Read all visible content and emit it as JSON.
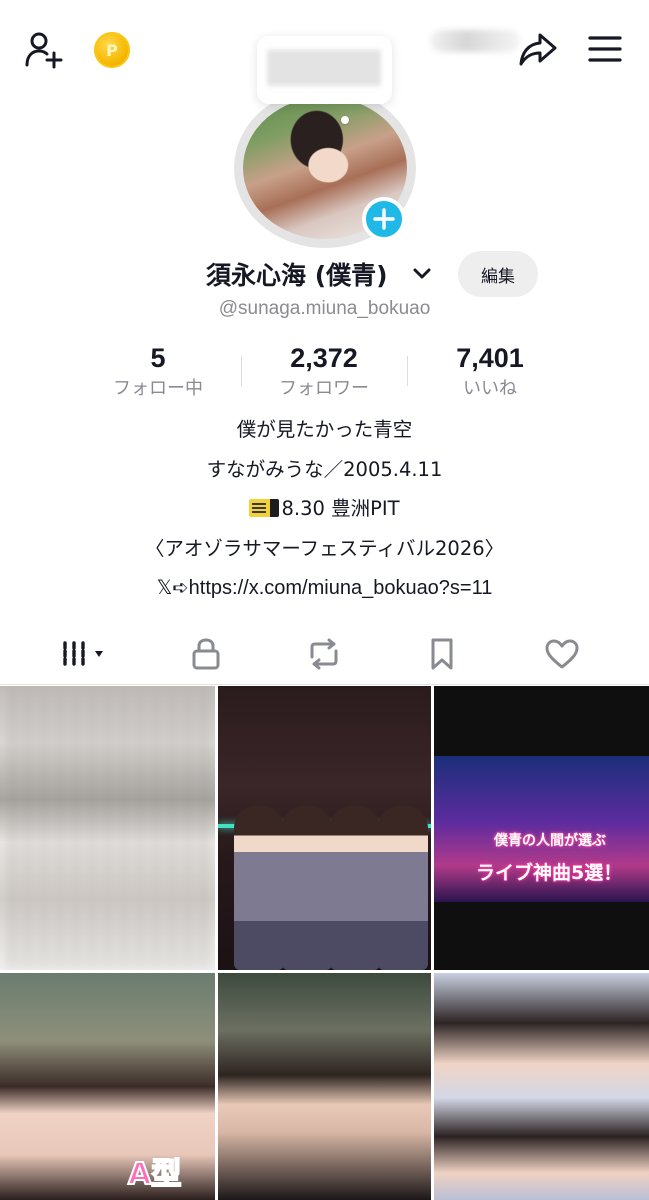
{
  "profile": {
    "display_name": "須永心海 (僕青)",
    "username": "@sunaga.miuna_bokuao",
    "edit_label": "編集"
  },
  "stats": [
    {
      "value": "5",
      "label": "フォロー中"
    },
    {
      "value": "2,372",
      "label": "フォロワー"
    },
    {
      "value": "7,401",
      "label": "いいね"
    }
  ],
  "bio": {
    "line1": "僕が見たかった青空",
    "line2": "すながみうな／2005.4.11",
    "line3": "8.30 豊洲PIT",
    "line4": "〈アオゾラサマーフェスティバル2026〉",
    "line5_prefix": "𝕏➪",
    "line5_url": "https://x.com/miuna_bokuao?s=11"
  },
  "coin_letter": "P",
  "tiles": {
    "tile3_caption1": "僕青の人間が選ぶ",
    "tile3_caption2": "ライブ神曲5選！",
    "tile4_badge": "A型"
  },
  "colors": {
    "accent": "#20b8e6",
    "text": "#161823",
    "secondary": "#8a8b91"
  },
  "icons": [
    "add-friend-icon",
    "coin-icon",
    "share-icon",
    "menu-icon",
    "plus-icon",
    "chevron-down-icon",
    "grid-icon",
    "lock-icon",
    "repost-icon",
    "bookmark-icon",
    "heart-icon",
    "ticket-icon"
  ]
}
